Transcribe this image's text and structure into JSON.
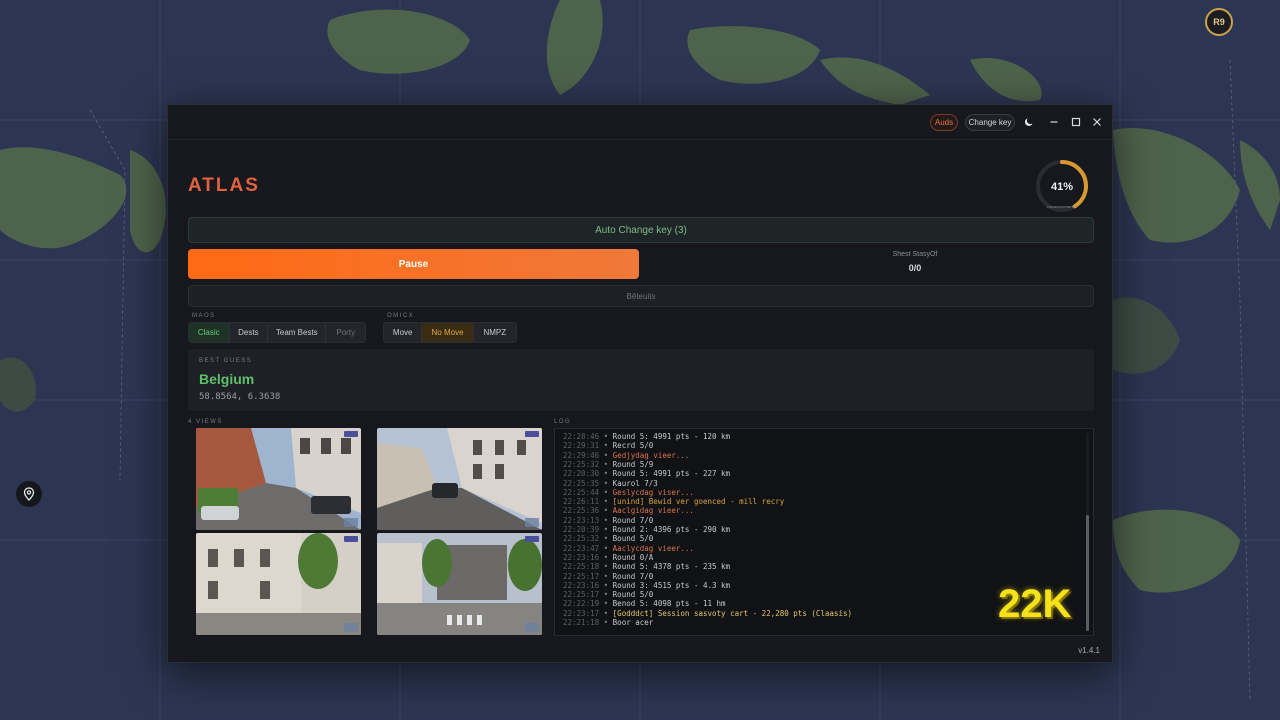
{
  "map": {
    "avatar_label": "R9"
  },
  "titlebar": {
    "auds_label": "Auds",
    "change_key_label": "Change key"
  },
  "app": {
    "title": "ATLAS",
    "gauge_value": "41%",
    "gauge_fraction": 0.41,
    "gauge_caption": "ᴛʀᴀᴄᴋᴘᴏɪɴᴛᴍᴇᴛʀᴇ"
  },
  "controls": {
    "auto_change_key": "Auto Change key (3)",
    "pause": "Pause",
    "sheet_label": "Shest StasyOf",
    "sheet_value": "0/0",
    "results": "Bêteuits"
  },
  "modes": {
    "label": "MAOS",
    "items": [
      "Clasic",
      "Dests",
      "Team Bests",
      "Porty"
    ]
  },
  "movement": {
    "label": "OMICX",
    "items": [
      "Move",
      "No Move",
      "NMPZ"
    ]
  },
  "best_guess": {
    "label": "BEST GUESS",
    "country": "Belgium",
    "coords": "58.8564,  6.3638"
  },
  "views": {
    "label": "4 VIEWS"
  },
  "log": {
    "label": "LOG",
    "lines": [
      {
        "ts": "22:28:46",
        "text": "Round 5: 4991 pts - 120 km",
        "color": "#c7c9cf"
      },
      {
        "ts": "22:29:31",
        "text": "Recrd 5/0",
        "color": "#c7c9cf"
      },
      {
        "ts": "22:29:46",
        "text": "Gedjydag vieer...",
        "color": "#d9734a"
      },
      {
        "ts": "22:25:32",
        "text": "Round 5/9",
        "color": "#c7c9cf"
      },
      {
        "ts": "22:20:30",
        "text": "Round 5: 4991 pts - 227 km",
        "color": "#c7c9cf"
      },
      {
        "ts": "22:25:35",
        "text": "Kaurol 7/3",
        "color": "#c7c9cf"
      },
      {
        "ts": "22:25:44",
        "text": "Geslycdag viser...",
        "color": "#d9734a"
      },
      {
        "ts": "22:26:11",
        "text": "[unind] Bewid ver goenced - mill recry",
        "color": "#d6a23c"
      },
      {
        "ts": "22:25:36",
        "text": "Aaclgidag vieer...",
        "color": "#d9734a"
      },
      {
        "ts": "22:23:13",
        "text": "Round 7/0",
        "color": "#c7c9cf"
      },
      {
        "ts": "22:20:39",
        "text": "Round 2: 4396 pts - 290 km",
        "color": "#c7c9cf"
      },
      {
        "ts": "22:25:32",
        "text": "Bound 5/0",
        "color": "#c7c9cf"
      },
      {
        "ts": "22:23:47",
        "text": "Aaclycdag vieer...",
        "color": "#d9734a"
      },
      {
        "ts": "22:23:16",
        "text": "Round 0/A",
        "color": "#c7c9cf"
      },
      {
        "ts": "22:25:18",
        "text": "Round 5: 4378 pts - 235 km",
        "color": "#c7c9cf"
      },
      {
        "ts": "22:25:17",
        "text": "Round 7/0",
        "color": "#c7c9cf"
      },
      {
        "ts": "22:23:16",
        "text": "Round 3: 4515 pts - 4.3 km",
        "color": "#c7c9cf"
      },
      {
        "ts": "22:25:17",
        "text": "Round 5/0",
        "color": "#c7c9cf"
      },
      {
        "ts": "22:22:19",
        "text": "Benod 5: 4098 pts - 11 hm",
        "color": "#c7c9cf"
      },
      {
        "ts": "22:23:17",
        "text": "[Godddct] Session sasvoty cart - 22,280 pts (Claasis)",
        "color": "#e3c766"
      },
      {
        "ts": "22:21:18",
        "text": "Boor acer",
        "color": "#c7c9cf"
      }
    ]
  },
  "overlay": {
    "score": "22K"
  },
  "footer": {
    "version": "v1.4.1"
  },
  "colors": {
    "accent": "#e0633e",
    "pause": "#ff6a14",
    "success": "#5fbf6a",
    "highlight": "#f5e21a"
  }
}
